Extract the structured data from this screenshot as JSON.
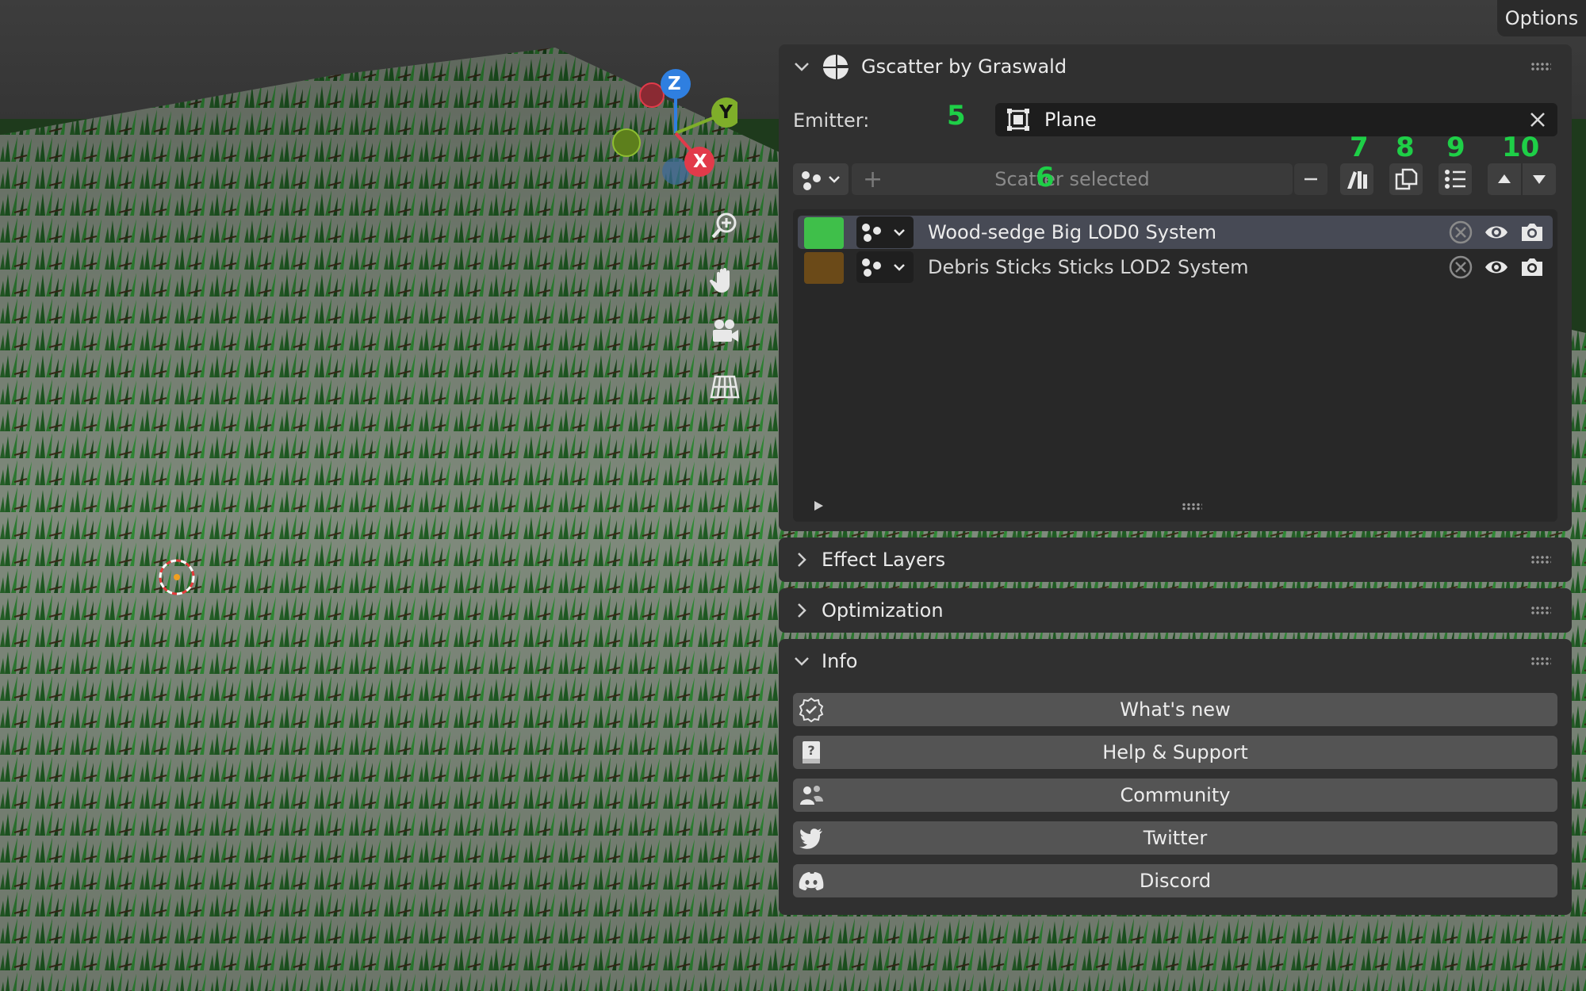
{
  "viewport": {
    "options_label": "Options",
    "gizmo": {
      "z": "Z",
      "y": "Y",
      "x": "X"
    }
  },
  "panel": {
    "gscatter": {
      "title": "Gscatter by Graswald",
      "emitter_label": "Emitter:",
      "emitter_value": "Plane",
      "scatter_selected_label": "Scatter selected",
      "markers": {
        "m5": "5",
        "m6": "6",
        "m7": "7",
        "m8": "8",
        "m9": "9",
        "m10": "10"
      },
      "systems": [
        {
          "name": "Wood-sedge Big LOD0 System",
          "color": "#3fbf4a",
          "selected": true
        },
        {
          "name": "Debris Sticks Sticks LOD2 System",
          "color": "#6b4a18",
          "selected": false
        }
      ]
    },
    "effect_layers_title": "Effect Layers",
    "optimization_title": "Optimization",
    "info": {
      "title": "Info",
      "buttons": [
        {
          "label": "What's new",
          "icon": "badge-check-icon"
        },
        {
          "label": "Help & Support",
          "icon": "help-book-icon"
        },
        {
          "label": "Community",
          "icon": "community-icon"
        },
        {
          "label": "Twitter",
          "icon": "twitter-icon"
        },
        {
          "label": "Discord",
          "icon": "discord-icon"
        }
      ]
    }
  },
  "colors": {
    "accent_green": "#1ecf47",
    "panel_bg": "#303030",
    "selected_row": "#474a55"
  }
}
